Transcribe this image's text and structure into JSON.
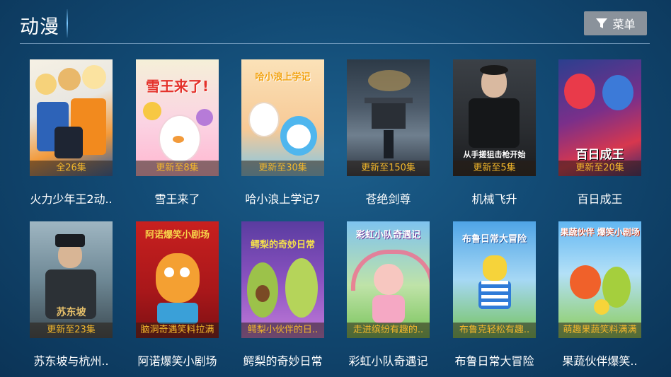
{
  "header": {
    "title": "动漫",
    "menu_label": "菜单",
    "menu_icon": "filter-icon"
  },
  "items": [
    {
      "name": "火力少年王2动..",
      "badge": "全26集",
      "poster_text": ""
    },
    {
      "name": "雪王来了",
      "badge": "更新至8集",
      "poster_text": "雪王来了!"
    },
    {
      "name": "哈小浪上学记7",
      "badge": "更新至30集",
      "poster_text": "哈小浪上学记"
    },
    {
      "name": "苍绝剑尊",
      "badge": "更新至150集",
      "poster_text": ""
    },
    {
      "name": "机械飞升",
      "badge": "更新至5集",
      "poster_text": "从手搓狙击枪开始"
    },
    {
      "name": "百日成王",
      "badge": "更新至20集",
      "poster_text": "百日成王"
    },
    {
      "name": "苏东坡与杭州..",
      "badge": "更新至23集",
      "poster_text": "苏东坡"
    },
    {
      "name": "阿诺爆笑小剧场",
      "badge": "脑洞奇遇笑料拉满",
      "poster_text": "阿诺爆笑小剧场"
    },
    {
      "name": "鳄梨的奇妙日常",
      "badge": "鳄梨小伙伴的日..",
      "poster_text": "鳄梨的奇妙日常"
    },
    {
      "name": "彩虹小队奇遇记",
      "badge": "走进缤纷有趣的..",
      "poster_text": "彩虹小队奇遇记"
    },
    {
      "name": "布鲁日常大冒险",
      "badge": "布鲁克轻松有趣..",
      "poster_text": "布鲁日常大冒险"
    },
    {
      "name": "果蔬伙伴爆笑..",
      "badge": "萌趣果蔬笑料满满",
      "poster_text": "果蔬伙伴 爆笑小剧场"
    }
  ],
  "colors": {
    "background": "#124a74",
    "badge_text": "#f3b72b",
    "menu_button": "#8a929b"
  }
}
